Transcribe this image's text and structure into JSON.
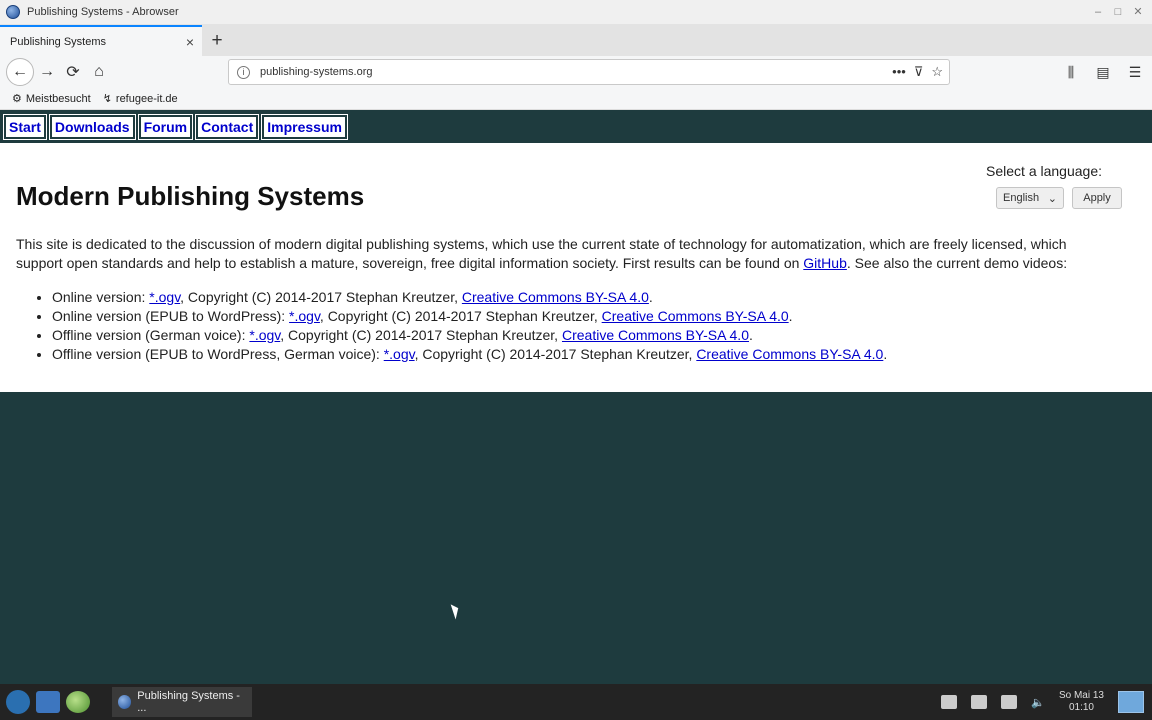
{
  "window": {
    "title": "Publishing Systems - Abrowser"
  },
  "tabs": [
    {
      "label": "Publishing Systems",
      "close": "×"
    }
  ],
  "new_tab": "+",
  "nav": {
    "back": "←",
    "forward": "→",
    "reload": "⟳",
    "home": "⌂"
  },
  "urlbar": {
    "url": "publishing-systems.org",
    "info": "i",
    "more": "•••",
    "pocket": "⊽",
    "star": "☆"
  },
  "toolbar_right": {
    "library": "⫼",
    "sidebar": "▤",
    "menu": "☰"
  },
  "bookmarks": [
    {
      "icon": "⚙",
      "label": "Meistbesucht"
    },
    {
      "icon": "↯",
      "label": "refugee-it.de"
    }
  ],
  "site_nav": [
    "Start",
    "Downloads",
    "Forum",
    "Contact",
    "Impressum"
  ],
  "page": {
    "title": "Modern Publishing Systems",
    "language_label": "Select a language:",
    "language_value": "English",
    "apply_label": "Apply",
    "intro_before": "This site is dedicated to the discussion of modern digital publishing systems, which use the current state of technology for automatization, which are freely licensed, which support open standards and help to establish a mature, sovereign, free digital information society. First results can be found on ",
    "intro_link": "GitHub",
    "intro_after": ". See also the current demo videos:",
    "videos": [
      {
        "prefix": "Online version: ",
        "file": "*.ogv",
        "copyright": ", Copyright (C) 2014-2017 Stephan Kreutzer, ",
        "license": "Creative Commons BY-SA 4.0",
        "end": "."
      },
      {
        "prefix": "Online version (EPUB to WordPress): ",
        "file": "*.ogv",
        "copyright": ", Copyright (C) 2014-2017 Stephan Kreutzer, ",
        "license": "Creative Commons BY-SA 4.0",
        "end": "."
      },
      {
        "prefix": "Offline version (German voice): ",
        "file": "*.ogv",
        "copyright": ", Copyright (C) 2014-2017 Stephan Kreutzer, ",
        "license": "Creative Commons BY-SA 4.0",
        "end": "."
      },
      {
        "prefix": "Offline version (EPUB to WordPress, German voice): ",
        "file": "*.ogv",
        "copyright": ", Copyright (C) 2014-2017 Stephan Kreutzer, ",
        "license": "Creative Commons BY-SA 4.0",
        "end": "."
      }
    ]
  },
  "taskbar": {
    "task_label": "Publishing Systems - ...",
    "clock_date": "So Mai 13",
    "clock_time": "01:10"
  }
}
